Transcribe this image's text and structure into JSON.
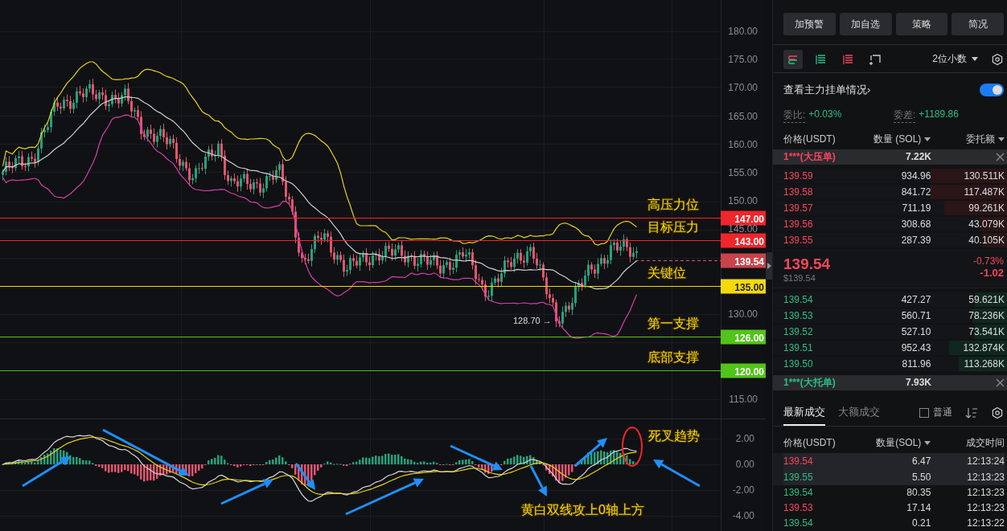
{
  "chart": {
    "price_axis": [
      "180.00",
      "175.00",
      "170.00",
      "165.00",
      "160.00",
      "155.00",
      "150.00",
      "145.00",
      "130.00",
      "115.00"
    ],
    "levels": [
      {
        "price": "147.00",
        "color": "#f0262c",
        "note": "高压力位"
      },
      {
        "price": "143.00",
        "color": "#f0262c",
        "note": "目标压力"
      },
      {
        "price": "135.00",
        "color": "#f5d90a",
        "note": "关键位"
      },
      {
        "price": "126.00",
        "color": "#52c41a",
        "note": "第一支撑"
      },
      {
        "price": "120.00",
        "color": "#52c41a",
        "note": "底部支撑"
      }
    ],
    "last_price": "139.54",
    "low_label": "128.70 →",
    "macd_axis": [
      "2.00",
      "0.00",
      "-2.00",
      "-4.00"
    ],
    "macd_notes": [
      "死叉趋势",
      "黄白双线攻上0轴上方"
    ]
  },
  "side": {
    "buttons": [
      "加预警",
      "加自选",
      "策略",
      "简况"
    ],
    "view_icons": [
      {
        "kind": "both",
        "selected": true
      },
      {
        "kind": "buy",
        "selected": false
      },
      {
        "kind": "sell",
        "selected": false
      },
      {
        "kind": "custom",
        "selected": false
      }
    ],
    "decimals": "2位小数",
    "main_orders": {
      "label": "查看主力挂单情况›",
      "on": true
    },
    "ratio": {
      "label": "委比:",
      "value": "+0.03%"
    },
    "diff": {
      "label": "委差:",
      "value": "+1189.86"
    },
    "book_columns": [
      {
        "label": "价格(USDT)",
        "dropdown": false
      },
      {
        "label": "数量 (SOL)",
        "dropdown": true
      },
      {
        "label": "委托额",
        "dropdown": true
      }
    ],
    "big_ask": {
      "label": "1***(大压单)",
      "amount": "7.22K",
      "color": "#f6465d"
    },
    "asks": [
      {
        "price": "139.59",
        "qty": "934.96",
        "total": "130.511K",
        "level": 0.33
      },
      {
        "price": "139.58",
        "qty": "841.72",
        "total": "117.487K",
        "level": 0.33
      },
      {
        "price": "139.57",
        "qty": "711.19",
        "total": "99.261K",
        "level": 0.27
      },
      {
        "price": "139.56",
        "qty": "308.68",
        "total": "43.079K",
        "level": 0.12
      },
      {
        "price": "139.55",
        "qty": "287.39",
        "total": "40.105K",
        "level": 0.11
      }
    ],
    "mid": {
      "price": "139.54",
      "usd": "$139.54",
      "change_pct": "-0.73%",
      "change": "-1.02"
    },
    "bids": [
      {
        "price": "139.54",
        "qty": "427.27",
        "total": "59.621K",
        "level": 0.14
      },
      {
        "price": "139.53",
        "qty": "560.71",
        "total": "78.236K",
        "level": 0.15
      },
      {
        "price": "139.52",
        "qty": "527.10",
        "total": "73.541K",
        "level": 0.14
      },
      {
        "price": "139.51",
        "qty": "952.43",
        "total": "132.874K",
        "level": 0.25
      },
      {
        "price": "139.50",
        "qty": "811.96",
        "total": "113.268K",
        "level": 0.21
      }
    ],
    "big_bid": {
      "label": "1***(大托单)",
      "amount": "7.93K",
      "color": "#2ebd85"
    },
    "trade_tabs": [
      {
        "label": "最新成交",
        "selected": true
      },
      {
        "label": "大额成交",
        "selected": false
      }
    ],
    "normal_filter": {
      "label": "普通",
      "checked": false
    },
    "trade_columns": [
      {
        "label": "价格(USDT)",
        "dropdown": false
      },
      {
        "label": "数量(SOL)",
        "dropdown": true
      },
      {
        "label": "成交时间",
        "dropdown": false
      }
    ],
    "trades": [
      {
        "price": "139.54",
        "qty": "6.47",
        "time": "12:13:24",
        "color": "#f6465d",
        "highlighted": true
      },
      {
        "price": "139.55",
        "qty": "5.50",
        "time": "12:13:23",
        "color": "#2ebd85",
        "highlighted": true
      },
      {
        "price": "139.54",
        "qty": "80.35",
        "time": "12:13:23",
        "color": "#2ebd85",
        "highlighted": false
      },
      {
        "price": "139.53",
        "qty": "17.14",
        "time": "12:13:23",
        "color": "#f6465d",
        "highlighted": false
      },
      {
        "price": "139.54",
        "qty": "0.21",
        "time": "12:13:22",
        "color": "#2ebd85",
        "highlighted": false
      }
    ]
  }
}
